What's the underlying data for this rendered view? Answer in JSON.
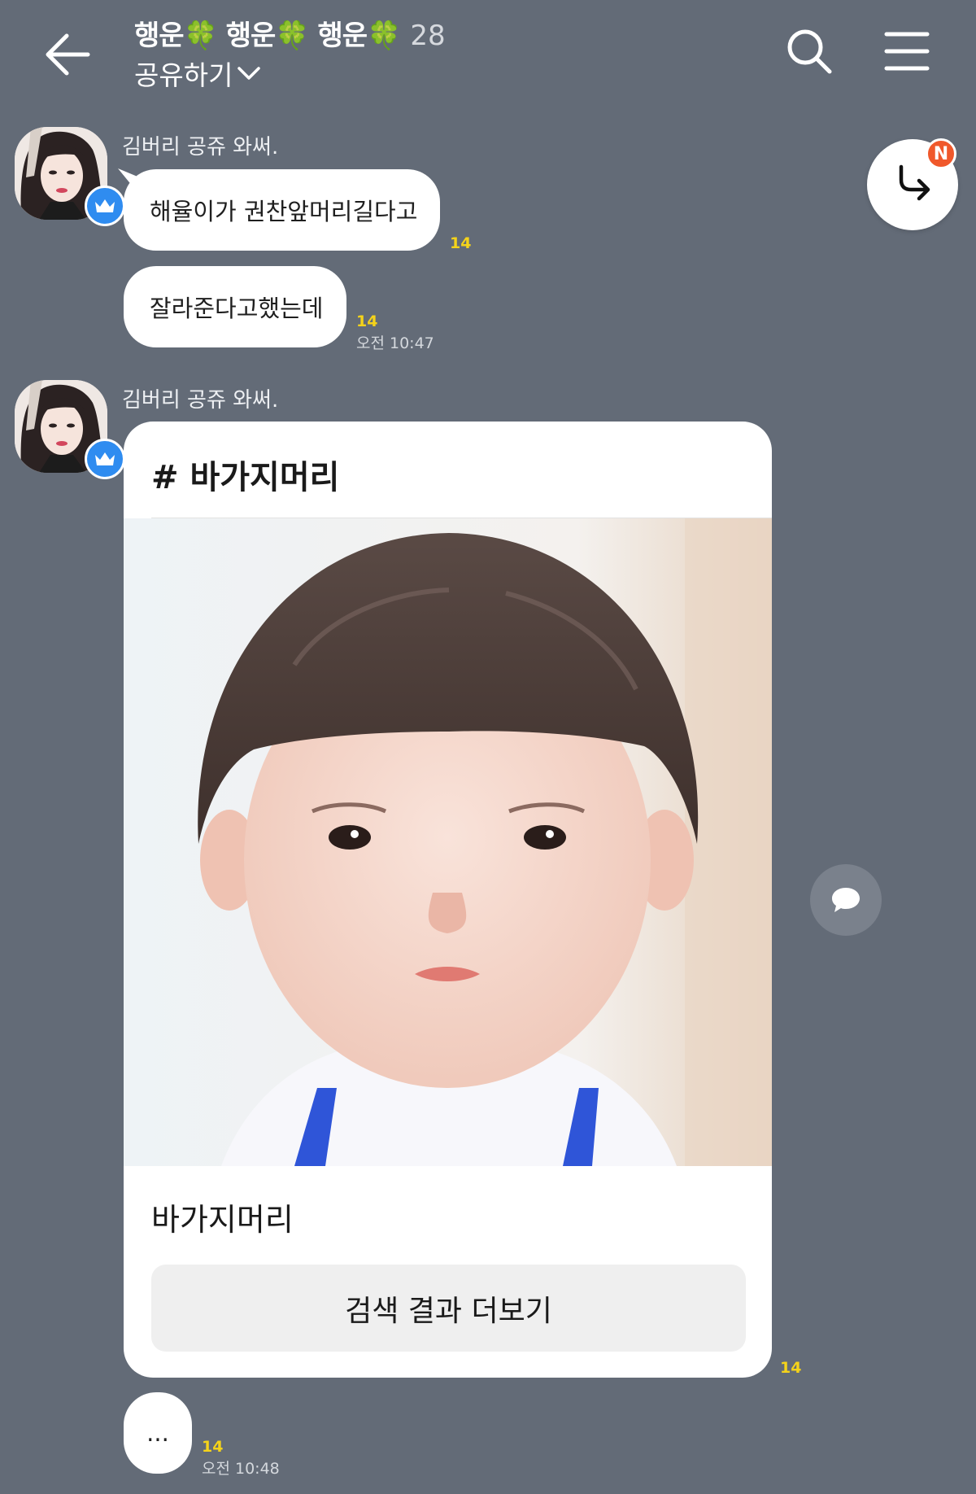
{
  "colors": {
    "background": "#636b77",
    "bubble": "#ffffff",
    "unread": "#f5d31a",
    "crown_badge": "#2f8cf0",
    "new_badge": "#f0582b"
  },
  "header": {
    "title": "행운🍀 행운🍀 행운🍀",
    "member_count": "28",
    "share_label": "공유하기",
    "icons": {
      "back": "back-arrow-icon",
      "share": "chevron-down-icon",
      "search": "search-icon",
      "menu": "menu-icon"
    }
  },
  "floating": {
    "new_badge": "N",
    "jump_icon": "jump-to-latest-icon",
    "reply_icon": "speech-bubble-icon"
  },
  "messages": [
    {
      "sender": "김버리 공쥬 와써.",
      "bubbles": [
        {
          "text": "해율이가 권찬앞머리길다고",
          "unread": "14",
          "time": ""
        },
        {
          "text": "잘라준다고했는데",
          "unread": "14",
          "time": "오전 10:47"
        }
      ]
    },
    {
      "sender": "김버리 공쥬 와써.",
      "card": {
        "header": "# 바가지머리",
        "title": "바가지머리",
        "button": "검색 결과 더보기",
        "unread": "14"
      },
      "bubbles": [
        {
          "text": "...",
          "unread": "14",
          "time": "오전 10:48"
        }
      ]
    }
  ]
}
